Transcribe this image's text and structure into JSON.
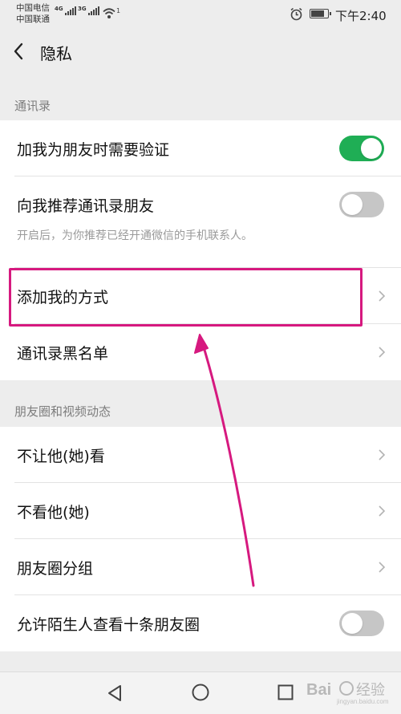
{
  "status_bar": {
    "carrier_1": "中国电信",
    "carrier_2": "中国联通",
    "net_1": "4G",
    "net_2": "3G",
    "wifi_badge": "1",
    "time": "下午2:40",
    "icons": [
      "signal-icon",
      "wifi-icon",
      "alarm-icon",
      "battery-icon"
    ]
  },
  "header": {
    "title": "隐私",
    "back_icon": "back-arrow-icon"
  },
  "sections": [
    {
      "title": "通讯录",
      "rows": [
        {
          "label": "加我为朋友时需要验证",
          "control": "toggle",
          "on": true
        },
        {
          "label": "向我推荐通讯录朋友",
          "description": "开启后，为你推荐已经开通微信的手机联系人。",
          "control": "toggle",
          "on": false
        },
        {
          "label": "添加我的方式",
          "control": "chevron",
          "highlighted": true
        },
        {
          "label": "通讯录黑名单",
          "control": "chevron"
        }
      ]
    },
    {
      "title": "朋友圈和视频动态",
      "rows": [
        {
          "label": "不让他(她)看",
          "control": "chevron"
        },
        {
          "label": "不看他(她)",
          "control": "chevron"
        },
        {
          "label": "朋友圈分组",
          "control": "chevron"
        },
        {
          "label": "允许陌生人查看十条朋友圈",
          "control": "toggle",
          "on": false
        }
      ]
    }
  ],
  "annotation": {
    "color": "#d6197f",
    "type": "highlight-box-with-arrow"
  },
  "colors": {
    "toggle_on": "#1fae55",
    "toggle_off": "#c6c6c6",
    "background": "#ededed"
  },
  "bottom_nav": [
    "back-triangle-icon",
    "home-circle-icon",
    "recent-square-icon"
  ],
  "watermark": {
    "text": "Bai经验",
    "url": "jingyan.baidu.com"
  }
}
